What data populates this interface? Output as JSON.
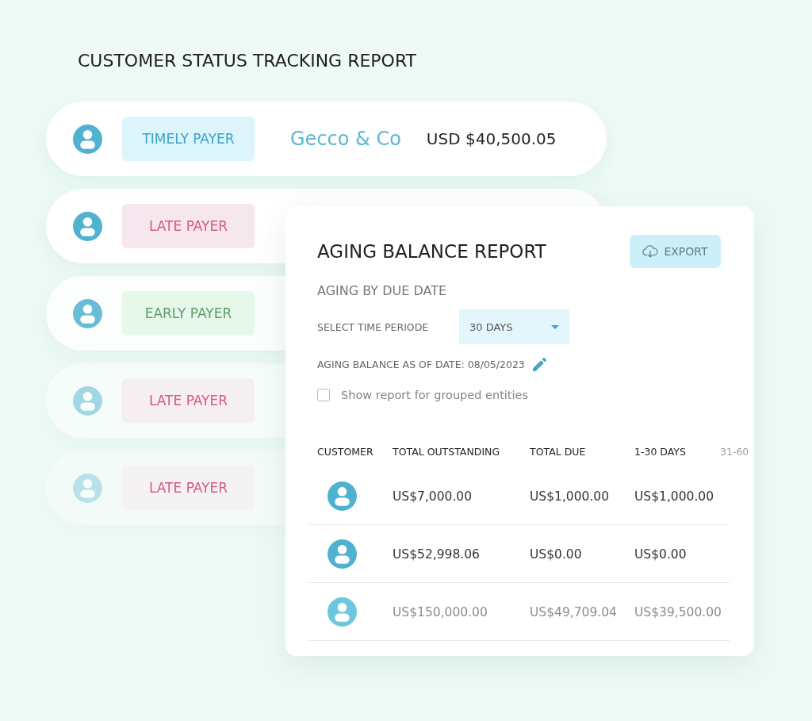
{
  "page": {
    "title": "CUSTOMER STATUS TRACKING REPORT"
  },
  "status_rows": [
    {
      "status": "TIMELY PAYER",
      "kind": "timely",
      "company": "Gecco & Co",
      "amount": "USD $40,500.05"
    },
    {
      "status": "LATE PAYER",
      "kind": "late"
    },
    {
      "status": "EARLY PAYER",
      "kind": "early"
    },
    {
      "status": "LATE PAYER",
      "kind": "late"
    },
    {
      "status": "LATE PAYER",
      "kind": "late"
    }
  ],
  "report": {
    "title": "AGING BALANCE REPORT",
    "export_button": "EXPORT",
    "subtitle": "AGING BY DUE DATE",
    "period": {
      "label": "SELECT TIME PERIODE",
      "value": "30 DAYS"
    },
    "as_of": "AGING BALANCE AS OF DATE: 08/05/2023",
    "grouped": {
      "label": "Show report for grouped entities",
      "checked": false
    },
    "table": {
      "columns": [
        "CUSTOMER",
        "TOTAL OUTSTANDING",
        "TOTAL DUE",
        "1-30 DAYS",
        "31-60"
      ],
      "rows": [
        {
          "cells": [
            "",
            "US$7,000.00",
            "US$1,000.00",
            "US$1,000.00"
          ]
        },
        {
          "cells": [
            "",
            "US$52,998.06",
            "US$0.00",
            "US$0.00"
          ]
        },
        {
          "cells": [
            "",
            "US$150,000.00",
            "US$49,709.04",
            "US$39,500.00"
          ]
        }
      ]
    }
  }
}
